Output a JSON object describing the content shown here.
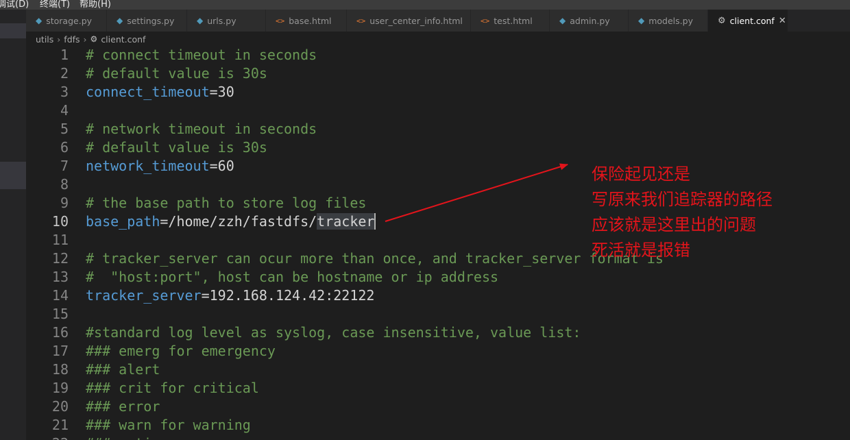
{
  "menubar": {
    "items": [
      "调试(D)",
      "终端(T)",
      "帮助(H)"
    ]
  },
  "tabs": [
    {
      "label": "storage.py",
      "icon": "python-icon",
      "active": false
    },
    {
      "label": "settings.py",
      "icon": "python-icon",
      "active": false
    },
    {
      "label": "urls.py",
      "icon": "python-icon",
      "active": false
    },
    {
      "label": "base.html",
      "icon": "html-icon",
      "active": false
    },
    {
      "label": "user_center_info.html",
      "icon": "html-icon",
      "active": false
    },
    {
      "label": "test.html",
      "icon": "html-icon",
      "active": false
    },
    {
      "label": "admin.py",
      "icon": "python-icon",
      "active": false
    },
    {
      "label": "models.py",
      "icon": "python-icon",
      "active": false
    },
    {
      "label": "client.conf",
      "icon": "gear-icon",
      "active": true
    }
  ],
  "breadcrumb": [
    "utils",
    "fdfs",
    "client.conf"
  ],
  "editor": {
    "current_line": 10,
    "lines": [
      {
        "n": "1",
        "parts": [
          {
            "t": "# connect timeout in seconds",
            "c": "comment"
          }
        ]
      },
      {
        "n": "2",
        "parts": [
          {
            "t": "# default value is 30s",
            "c": "comment"
          }
        ]
      },
      {
        "n": "3",
        "parts": [
          {
            "t": "connect_timeout",
            "c": "key"
          },
          {
            "t": "=30",
            "c": "val"
          }
        ]
      },
      {
        "n": "4",
        "parts": []
      },
      {
        "n": "5",
        "parts": [
          {
            "t": "# network timeout in seconds",
            "c": "comment"
          }
        ]
      },
      {
        "n": "6",
        "parts": [
          {
            "t": "# default value is 30s",
            "c": "comment"
          }
        ]
      },
      {
        "n": "7",
        "parts": [
          {
            "t": "network_timeout",
            "c": "key"
          },
          {
            "t": "=60",
            "c": "val"
          }
        ]
      },
      {
        "n": "8",
        "parts": []
      },
      {
        "n": "9",
        "parts": [
          {
            "t": "# the base path to store log files",
            "c": "comment"
          }
        ]
      },
      {
        "n": "10",
        "parts": [
          {
            "t": "base_path",
            "c": "key"
          },
          {
            "t": "=/home/zzh/fastdfs/",
            "c": "val"
          },
          {
            "t": "tracker",
            "c": "sel"
          }
        ]
      },
      {
        "n": "11",
        "parts": []
      },
      {
        "n": "12",
        "parts": [
          {
            "t": "# tracker_server can ocur more than once, and tracker_server format is",
            "c": "comment"
          }
        ]
      },
      {
        "n": "13",
        "parts": [
          {
            "t": "#  \"host:port\", host can be hostname or ip address",
            "c": "comment"
          }
        ]
      },
      {
        "n": "14",
        "parts": [
          {
            "t": "tracker_server",
            "c": "key"
          },
          {
            "t": "=192.168.124.42:22122",
            "c": "val"
          }
        ]
      },
      {
        "n": "15",
        "parts": []
      },
      {
        "n": "16",
        "parts": [
          {
            "t": "#standard log level as syslog, case insensitive, value list:",
            "c": "comment"
          }
        ]
      },
      {
        "n": "17",
        "parts": [
          {
            "t": "### emerg for emergency",
            "c": "comment"
          }
        ]
      },
      {
        "n": "18",
        "parts": [
          {
            "t": "### alert",
            "c": "comment"
          }
        ]
      },
      {
        "n": "19",
        "parts": [
          {
            "t": "### crit for critical",
            "c": "comment"
          }
        ]
      },
      {
        "n": "20",
        "parts": [
          {
            "t": "### error",
            "c": "comment"
          }
        ]
      },
      {
        "n": "21",
        "parts": [
          {
            "t": "### warn for warning",
            "c": "comment"
          }
        ]
      },
      {
        "n": "22",
        "parts": [
          {
            "t": "### notice",
            "c": "comment"
          }
        ]
      }
    ]
  },
  "annotation": {
    "color": "#e3141b",
    "lines": [
      "保险起见还是",
      "写原来我们追踪器的路径",
      "应该就是这里出的问题",
      "死活就是报错"
    ]
  },
  "colors": {
    "background": "#1e1e1e",
    "comment": "#6a9955",
    "key": "#569cd6",
    "text": "#d4d4d4"
  }
}
